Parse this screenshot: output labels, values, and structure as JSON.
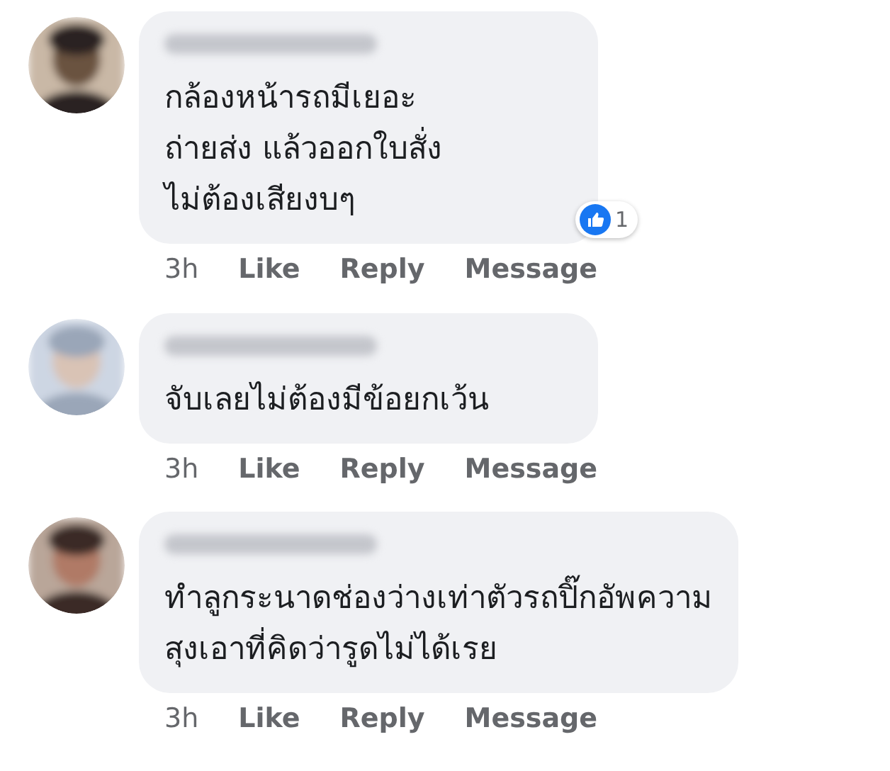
{
  "comments": [
    {
      "lines": [
        "กล้องหน้ารถมีเยอะ",
        "ถ่ายส่ง แล้วออกใบสั่ง",
        "ไม่ต้องเสียงบๆ"
      ],
      "reaction_count": "1",
      "time": "3h",
      "actions": [
        "Like",
        "Reply",
        "Message"
      ]
    },
    {
      "lines": [
        "จับเลยไม่ต้องมีข้อยกเว้น"
      ],
      "time": "3h",
      "actions": [
        "Like",
        "Reply",
        "Message"
      ]
    },
    {
      "lines": [
        "ทำลูกระนาดช่องว่างเท่าตัวรถปิ๊กอัพความ",
        "สุงเอาที่คิดว่ารูดไม่ได้เรย"
      ],
      "time": "3h",
      "actions": [
        "Like",
        "Reply",
        "Message"
      ]
    }
  ]
}
